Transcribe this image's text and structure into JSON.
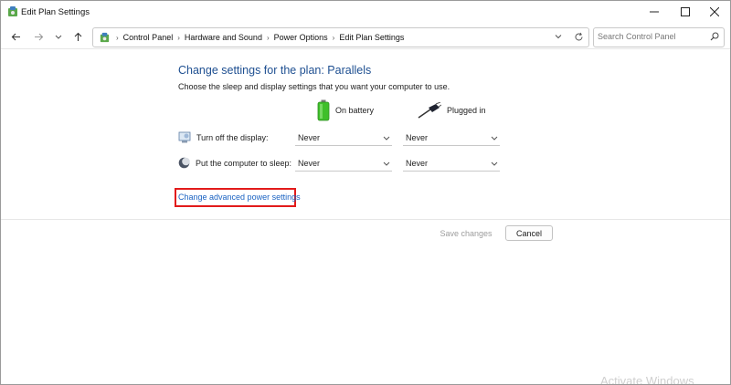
{
  "window": {
    "title": "Edit Plan Settings",
    "icon": "control-panel-icon"
  },
  "nav": {
    "breadcrumb": [
      "Control Panel",
      "Hardware and Sound",
      "Power Options",
      "Edit Plan Settings"
    ],
    "search_placeholder": "Search Control Panel"
  },
  "content": {
    "heading": "Change settings for the plan: Parallels",
    "description": "Choose the sleep and display settings that you want your computer to use.",
    "columns": {
      "battery": "On battery",
      "plugged": "Plugged in"
    },
    "rows": [
      {
        "label": "Turn off the display:",
        "battery": "Never",
        "plugged": "Never"
      },
      {
        "label": "Put the computer to sleep:",
        "battery": "Never",
        "plugged": "Never"
      }
    ],
    "advanced_link": "Change advanced power settings"
  },
  "buttons": {
    "save": "Save changes",
    "cancel": "Cancel"
  },
  "watermark": "Activate Windows",
  "colors": {
    "heading": "#1e4f91",
    "link": "#1a62c2",
    "highlight": "#e21b1b",
    "battery": "#3fbf2a"
  }
}
